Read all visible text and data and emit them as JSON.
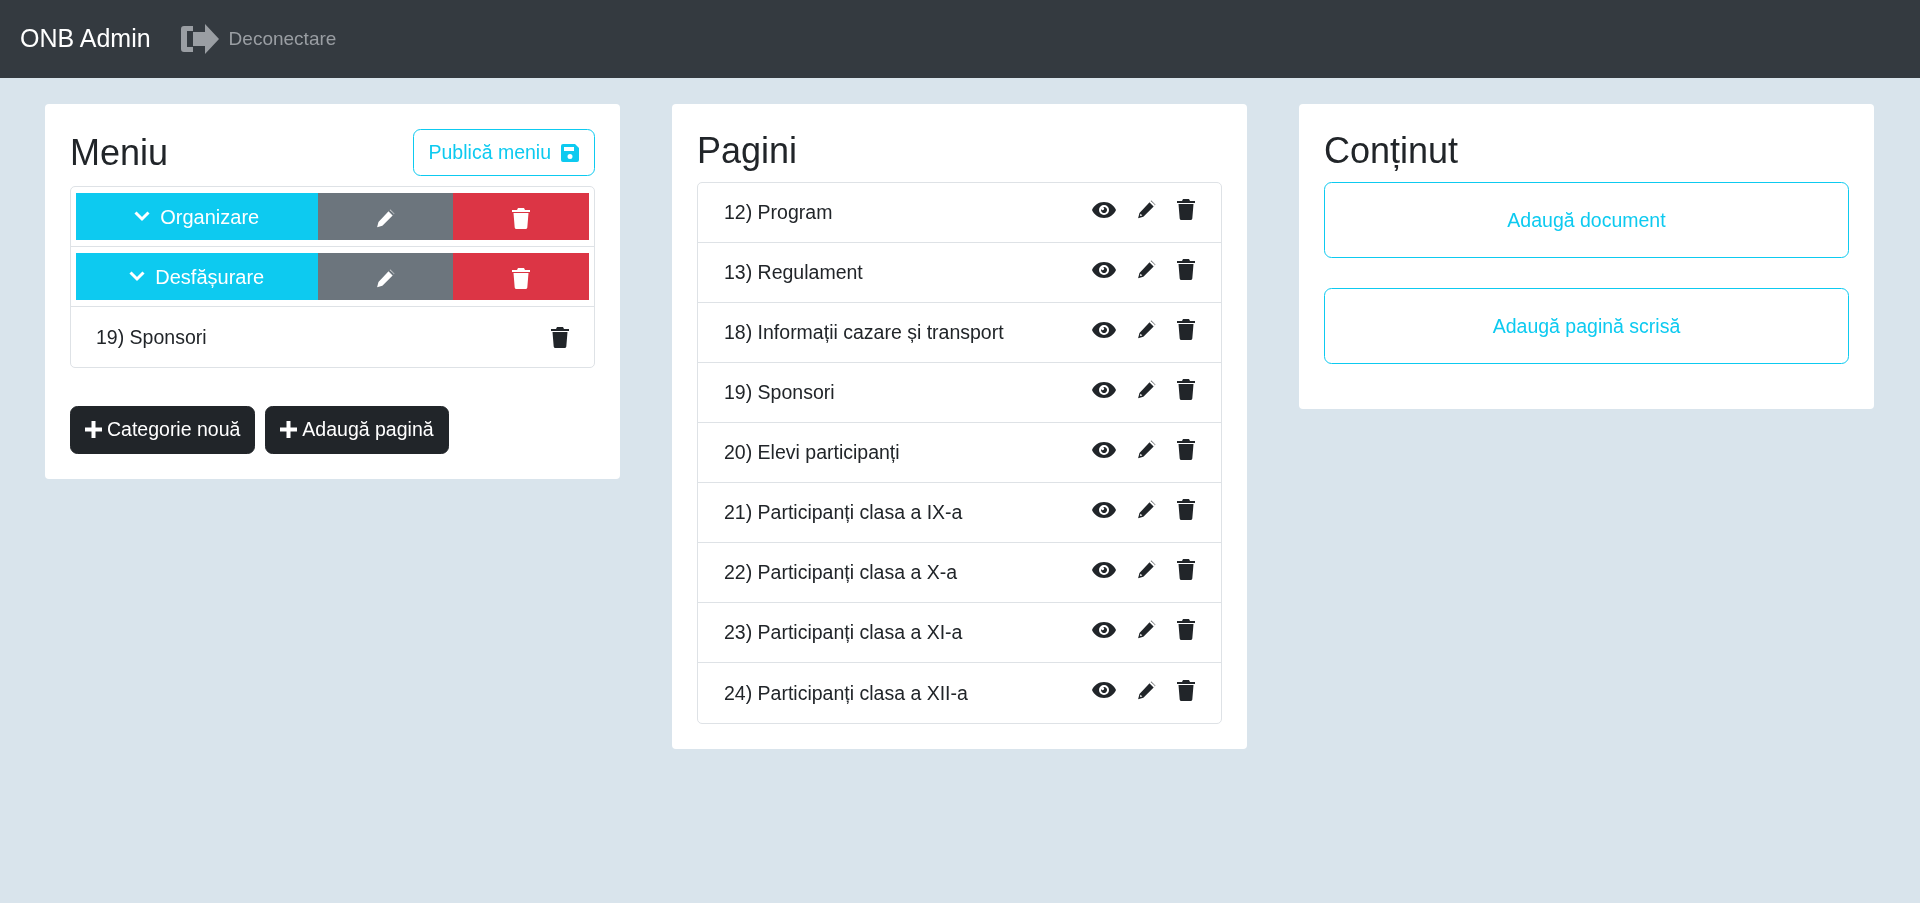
{
  "navbar": {
    "brand": "ONB Admin",
    "logout": "Deconectare"
  },
  "menu": {
    "title": "Meniu",
    "publish_button": "Publică meniu",
    "items": [
      {
        "kind": "category",
        "label": "Organizare",
        "expanded": false
      },
      {
        "kind": "category",
        "label": "Desfășurare",
        "expanded": false
      },
      {
        "kind": "page",
        "label": "19) Sponsori"
      }
    ],
    "buttons": [
      "Categorie nouă",
      "Adaugă pagină"
    ]
  },
  "pages": {
    "title": "Pagini",
    "items": [
      {
        "label": "12) Program"
      },
      {
        "label": "13) Regulament"
      },
      {
        "label": "18) Informații cazare și transport"
      },
      {
        "label": "19) Sponsori"
      },
      {
        "label": "20) Elevi participanți"
      },
      {
        "label": "21) Participanți clasa a IX-a"
      },
      {
        "label": "22) Participanți clasa a X-a"
      },
      {
        "label": "23) Participanți clasa a XI-a"
      },
      {
        "label": "24) Participanți clasa a XII-a"
      }
    ]
  },
  "content": {
    "title": "Conținut",
    "buttons": [
      "Adaugă document",
      "Adaugă pagină scrisă"
    ]
  }
}
